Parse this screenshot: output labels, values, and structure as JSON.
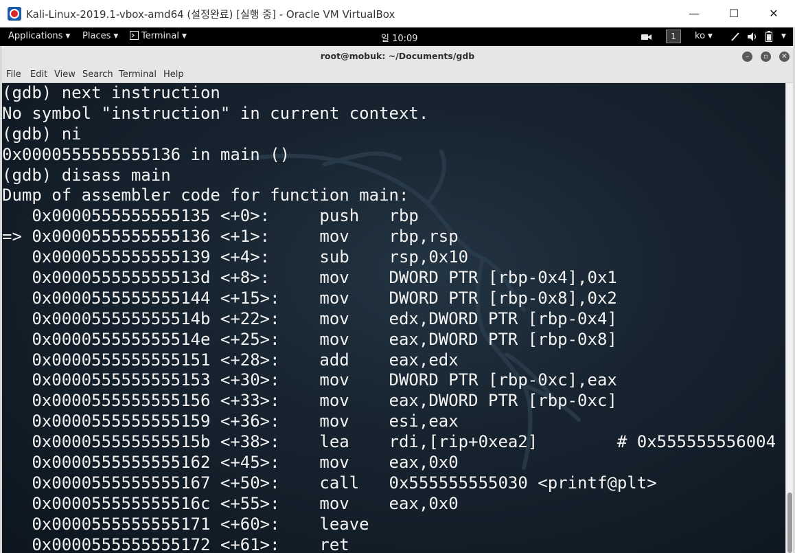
{
  "host_window": {
    "title": "Kali-Linux-2019.1-vbox-amd64 (설정완료) [실행 중] - Oracle VM VirtualBox",
    "minimize_glyph": "—",
    "maximize_glyph": "☐",
    "close_glyph": "✕"
  },
  "gnome_bar": {
    "applications": "Applications",
    "places": "Places",
    "terminal": "Terminal",
    "clock": "일 10:09",
    "workspace": "1",
    "input_method": "ko"
  },
  "terminal_window": {
    "title": "root@mobuk: ~/Documents/gdb",
    "menu": [
      "File",
      "Edit",
      "View",
      "Search",
      "Terminal",
      "Help"
    ]
  },
  "terminal_lines": [
    "(gdb) next instruction",
    "No symbol \"instruction\" in current context.",
    "(gdb) ni",
    "0x0000555555555136 in main ()",
    "(gdb) disass main",
    "Dump of assembler code for function main:",
    "   0x0000555555555135 <+0>:\tpush   rbp",
    "=> 0x0000555555555136 <+1>:\tmov    rbp,rsp",
    "   0x0000555555555139 <+4>:\tsub    rsp,0x10",
    "   0x000055555555513d <+8>:\tmov    DWORD PTR [rbp-0x4],0x1",
    "   0x0000555555555144 <+15>:\tmov    DWORD PTR [rbp-0x8],0x2",
    "   0x000055555555514b <+22>:\tmov    edx,DWORD PTR [rbp-0x4]",
    "   0x000055555555514e <+25>:\tmov    eax,DWORD PTR [rbp-0x8]",
    "   0x0000555555555151 <+28>:\tadd    eax,edx",
    "   0x0000555555555153 <+30>:\tmov    DWORD PTR [rbp-0xc],eax",
    "   0x0000555555555156 <+33>:\tmov    eax,DWORD PTR [rbp-0xc]",
    "   0x0000555555555159 <+36>:\tmov    esi,eax",
    "   0x000055555555515b <+38>:\tlea    rdi,[rip+0xea2]        # 0x555555556004",
    "   0x0000555555555162 <+45>:\tmov    eax,0x0",
    "   0x0000555555555167 <+50>:\tcall   0x555555555030 <printf@plt>",
    "   0x000055555555516c <+55>:\tmov    eax,0x0",
    "   0x0000555555555171 <+60>:\tleave  ",
    "   0x0000555555555172 <+61>:\tret    "
  ],
  "colors": {
    "gnome_bar": "#000000",
    "terminal_bg": "#172430",
    "terminal_text": "#f2f2f2"
  }
}
